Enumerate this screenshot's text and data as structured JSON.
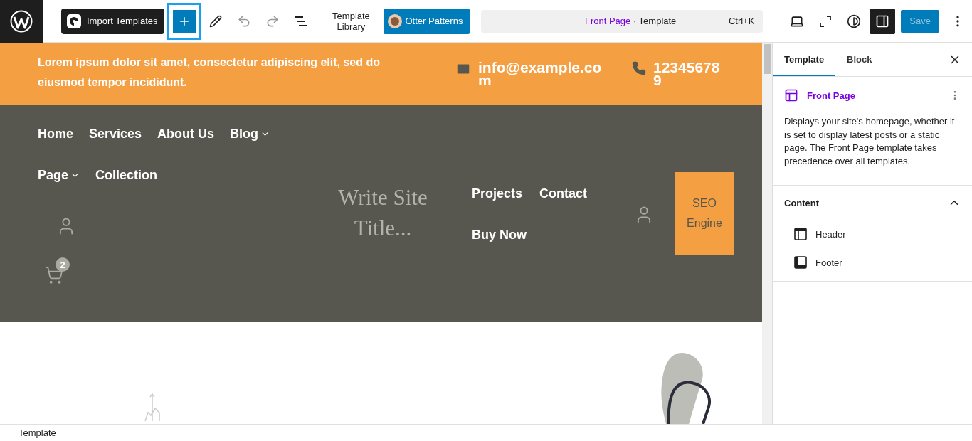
{
  "toolbar": {
    "import_button": "Import Templates",
    "inserter_active": true,
    "template_library": "Template Library",
    "otter_button": "Otter Patterns",
    "command": {
      "title": "Front Page",
      "type": "· Template",
      "shortcut": "Ctrl+K"
    },
    "save": {
      "label": "Save",
      "disabled": true
    },
    "settings_active": true
  },
  "canvas": {
    "announcement": "Lorem ipsum dolor sit amet, consectetur adipiscing elit, sed do eiusmod tempor incididunt.",
    "email": "info@example.com",
    "phone": "123456789",
    "nav_left": [
      {
        "label": "Home",
        "dropdown": false
      },
      {
        "label": "Services",
        "dropdown": false
      },
      {
        "label": "About Us",
        "dropdown": false
      },
      {
        "label": "Blog",
        "dropdown": true
      }
    ],
    "nav_left_2": [
      {
        "label": "Page",
        "dropdown": true
      },
      {
        "label": "Collection",
        "dropdown": false
      }
    ],
    "cart_count": "2",
    "site_title": "Write Site Title...",
    "nav_right": [
      {
        "label": "Projects"
      },
      {
        "label": "Contact"
      },
      {
        "label": "Buy Now"
      }
    ],
    "cta": "SEO Engine"
  },
  "sidebar": {
    "tabs": [
      {
        "label": "Template",
        "selected": true
      },
      {
        "label": "Block",
        "selected": false
      }
    ],
    "template_name": "Front Page",
    "description": "Displays your site's homepage, whether it is set to display latest posts or a static page. The Front Page template takes precedence over all templates.",
    "content": {
      "title": "Content",
      "expanded": true,
      "items": [
        {
          "label": "Header",
          "kind": "header"
        },
        {
          "label": "Footer",
          "kind": "footer"
        }
      ]
    }
  },
  "status_bar": "Template"
}
